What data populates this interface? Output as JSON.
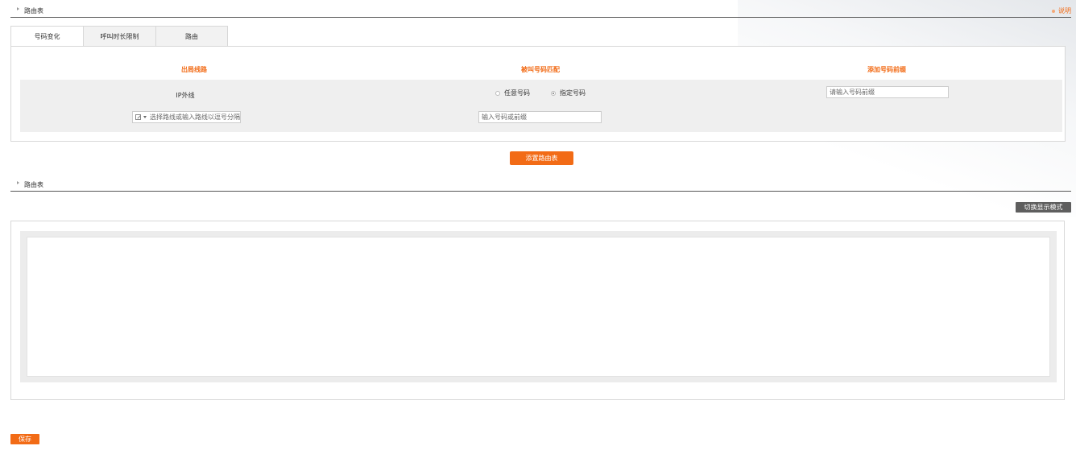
{
  "section1": {
    "title": "路由表"
  },
  "help": {
    "label": "说明"
  },
  "tabs": [
    {
      "label": "号码变化",
      "active": true
    },
    {
      "label": "呼叫时长限制",
      "active": false
    },
    {
      "label": "路由",
      "active": false
    }
  ],
  "columns": {
    "outbound_line": "出局线路",
    "called_match": "被叫号码匹配",
    "add_prefix": "添加号码前缀"
  },
  "row": {
    "line_name": "IP外线",
    "radio_any": "任意号码",
    "radio_specified": "指定号码",
    "selected_radio": "指定号码",
    "prefix_placeholder": "请输入号码前缀",
    "number_placeholder": "输入号码或前缀",
    "route_select_placeholder": "选择路线或输入路线以逗号分隔"
  },
  "buttons": {
    "add_route": "添置路由表",
    "toggle_display": "切换显示模式",
    "save": "保存"
  },
  "section2": {
    "title": "路由表"
  },
  "colors": {
    "accent": "#f26b16",
    "dark_button": "#5e5e5e",
    "panel_grey": "#efefef"
  }
}
